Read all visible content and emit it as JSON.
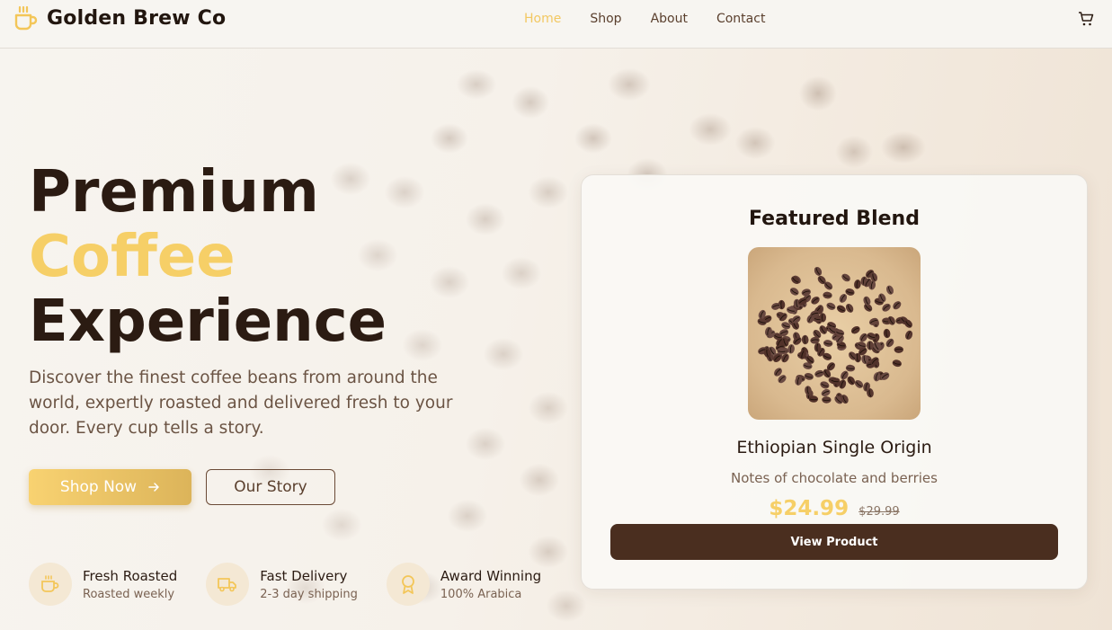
{
  "brand": {
    "name": "Golden Brew Co",
    "logo_icon": "coffee-cup-icon",
    "accent": "#f6cf67"
  },
  "nav": {
    "items": [
      {
        "label": "Home",
        "active": true
      },
      {
        "label": "Shop",
        "active": false
      },
      {
        "label": "About",
        "active": false
      },
      {
        "label": "Contact",
        "active": false
      }
    ],
    "cart_icon": "shopping-cart-icon"
  },
  "hero": {
    "title_line1": "Premium",
    "title_line2": "Coffee",
    "title_line3": "Experience",
    "description": "Discover the finest coffee beans from around the world, expertly roasted and delivered fresh to your door. Every cup tells a story.",
    "primary_button": "Shop Now",
    "primary_button_icon": "arrow-right-icon",
    "secondary_button": "Our Story"
  },
  "features": [
    {
      "title": "Fresh Roasted",
      "subtitle": "Roasted weekly",
      "icon": "coffee-cup-icon"
    },
    {
      "title": "Fast Delivery",
      "subtitle": "2-3 day shipping",
      "icon": "truck-icon"
    },
    {
      "title": "Award Winning",
      "subtitle": "100% Arabica",
      "icon": "award-icon"
    }
  ],
  "featured": {
    "heading": "Featured Blend",
    "product_name": "Ethiopian Single Origin",
    "notes": "Notes of chocolate and berries",
    "price": "$24.99",
    "original_price": "$29.99",
    "button": "View Product"
  },
  "colors": {
    "dark_brown": "#4a2e1f",
    "gold": "#f6cf67",
    "text_brown": "#6b5444"
  }
}
